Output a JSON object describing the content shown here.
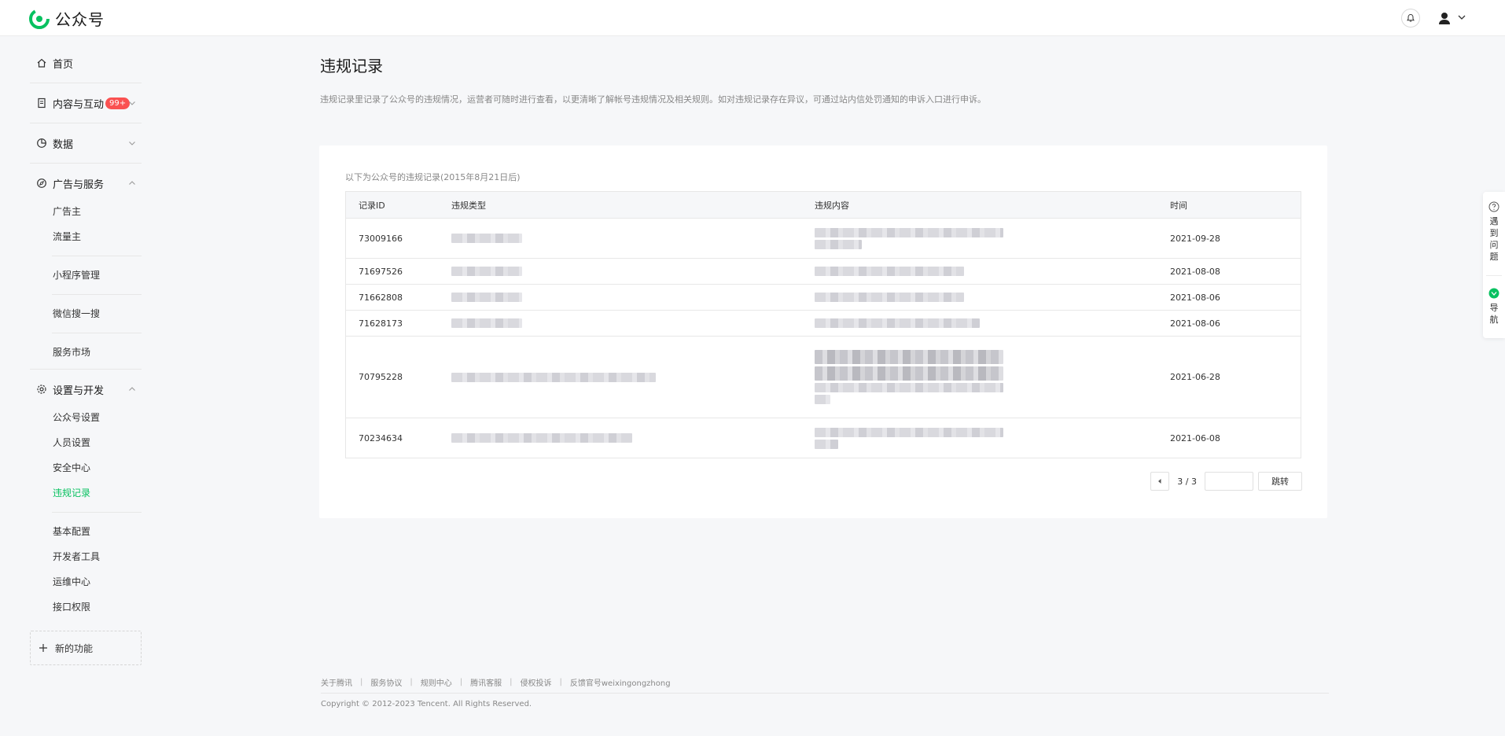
{
  "header": {
    "logo_text": "公众号",
    "brand_color": "#07c160"
  },
  "sidebar": {
    "home": "首页",
    "content": {
      "label": "内容与互动",
      "badge": "99+"
    },
    "data": "数据",
    "ads": {
      "label": "广告与服务",
      "items": [
        "广告主",
        "流量主",
        "小程序管理",
        "微信搜一搜",
        "服务市场"
      ]
    },
    "settings": {
      "label": "设置与开发",
      "items": [
        "公众号设置",
        "人员设置",
        "安全中心",
        "违规记录",
        "基本配置",
        "开发者工具",
        "运维中心",
        "接口权限"
      ]
    },
    "new_feature": "新的功能"
  },
  "main": {
    "title": "违规记录",
    "description": "违规记录里记录了公众号的违规情况，运营者可随时进行查看，以更清晰了解帐号违规情况及相关规则。如对违规记录存在异议，可通过站内信处罚通知的申诉入口进行申诉。",
    "caption": "以下为公众号的违规记录(2015年8月21日后)",
    "table": {
      "headers": [
        "记录ID",
        "违规类型",
        "违规内容",
        "时间"
      ],
      "rows": [
        {
          "id": "73009166",
          "time": "2021-09-28"
        },
        {
          "id": "71697526",
          "time": "2021-08-08"
        },
        {
          "id": "71662808",
          "time": "2021-08-06"
        },
        {
          "id": "71628173",
          "time": "2021-08-06"
        },
        {
          "id": "70795228",
          "time": "2021-06-28"
        },
        {
          "id": "70234634",
          "time": "2021-06-08"
        }
      ]
    },
    "pager": {
      "page_text": "3 / 3",
      "input_value": "",
      "jump_label": "跳转"
    }
  },
  "footer": {
    "links": [
      "关于腾讯",
      "服务协议",
      "规则中心",
      "腾讯客服",
      "侵权投诉",
      "反馈官号weixingongzhong"
    ],
    "copyright": "Copyright © 2012-2023 Tencent. All Rights Reserved."
  },
  "float": {
    "help": "遇到问题",
    "nav": "导航"
  }
}
